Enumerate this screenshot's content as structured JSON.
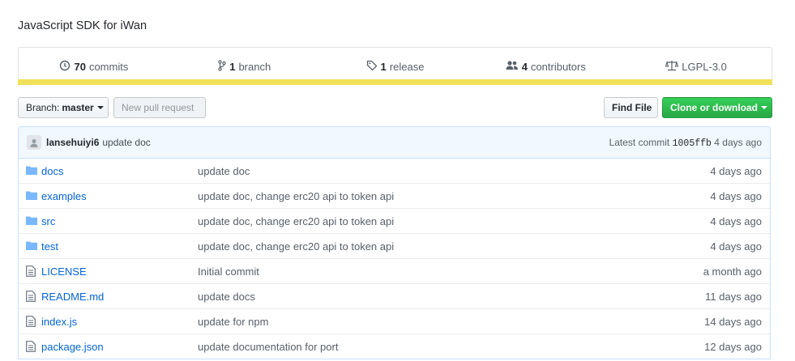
{
  "repo": {
    "description": "JavaScript SDK for iWan"
  },
  "summary": {
    "commits_count": "70",
    "commits_label": "commits",
    "branch_count": "1",
    "branch_label": "branch",
    "release_count": "1",
    "release_label": "release",
    "contributors_count": "4",
    "contributors_label": "contributors",
    "license": "LGPL-3.0",
    "language_color": "#f1e05a"
  },
  "toolbar": {
    "branch_prefix": "Branch:",
    "branch_name": "master",
    "new_pr_label": "New pull request",
    "find_file_label": "Find File",
    "clone_label": "Clone or download"
  },
  "latest_commit": {
    "author": "lansehuiyi6",
    "message": "update doc",
    "prefix": "Latest commit",
    "sha": "1005ffb",
    "age": "4 days ago"
  },
  "files": [
    {
      "type": "dir",
      "name": "docs",
      "message": "update doc",
      "age": "4 days ago"
    },
    {
      "type": "dir",
      "name": "examples",
      "message": "update doc, change erc20 api to token api",
      "age": "4 days ago"
    },
    {
      "type": "dir",
      "name": "src",
      "message": "update doc, change erc20 api to token api",
      "age": "4 days ago"
    },
    {
      "type": "dir",
      "name": "test",
      "message": "update doc, change erc20 api to token api",
      "age": "4 days ago"
    },
    {
      "type": "file",
      "name": "LICENSE",
      "message": "Initial commit",
      "age": "a month ago"
    },
    {
      "type": "file",
      "name": "README.md",
      "message": "update docs",
      "age": "11 days ago"
    },
    {
      "type": "file",
      "name": "index.js",
      "message": "update for npm",
      "age": "14 days ago"
    },
    {
      "type": "file",
      "name": "package.json",
      "message": "update documentation for port",
      "age": "12 days ago"
    }
  ]
}
